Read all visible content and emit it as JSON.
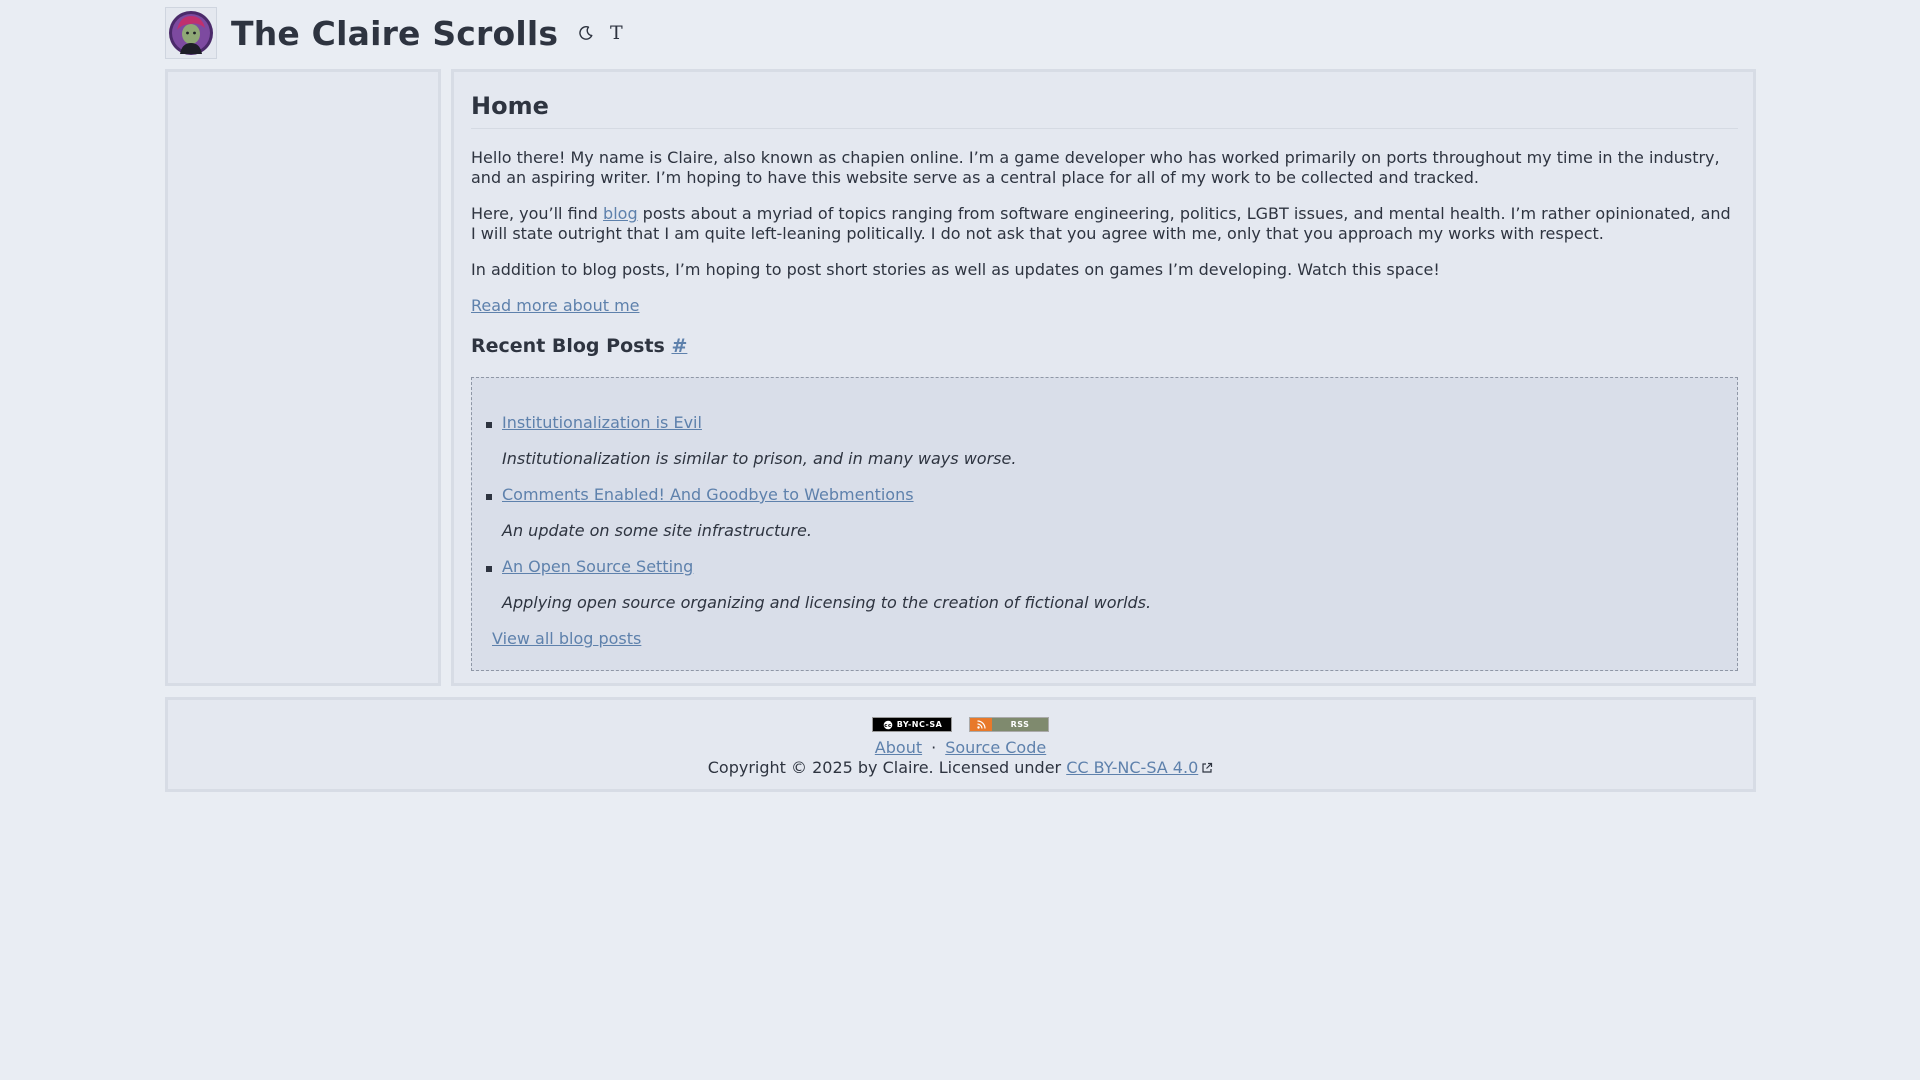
{
  "header": {
    "site_title": "The Claire Scrolls",
    "theme_toggle_icon": "moon-icon",
    "font_toggle_icon": "T"
  },
  "main": {
    "page_title": "Home",
    "intro": "Hello there! My name is Claire, also known as chapien online. I’m a game developer who has worked primarily on ports throughout my time in the industry, and an aspiring writer. I’m hoping to have this website serve as a central place for all of my work to be collected and tracked.",
    "topics_before": "Here, you’ll find ",
    "topics_link": "blog",
    "topics_after": " posts about a myriad of topics ranging from software engineering, politics, LGBT issues, and mental health. I’m rather opinionated, and I will state outright that I am quite left-leaning politically. I do not ask that you agree with me, only that you approach my works with respect.",
    "plans": "In addition to blog posts, I’m hoping to post short stories as well as updates on games I’m developing. Watch this space!",
    "read_more": "Read more about me",
    "recent_title": "Recent Blog Posts",
    "recent_anchor": "#",
    "posts": [
      {
        "title": "Institutionalization is Evil",
        "description": "Institutionalization is similar to prison, and in many ways worse."
      },
      {
        "title": "Comments Enabled! And Goodbye to Webmentions",
        "description": "An update on some site infrastructure."
      },
      {
        "title": "An Open Source Setting",
        "description": "Applying open source organizing and licensing to the creation of fictional worlds."
      }
    ],
    "view_all": "View all blog posts"
  },
  "footer": {
    "cc_badge": "BY-NC-SA",
    "rss_badge": "RSS",
    "about_link": "About",
    "separator": "·",
    "source_link": "Source Code",
    "copyright": "Copyright © 2025 by Claire. Licensed under ",
    "license_link": "CC BY-NC-SA 4.0"
  },
  "colors": {
    "background": "#e9edf3",
    "panel": "#e4e8f0",
    "link": "#5e81ac",
    "text": "#2e3440"
  }
}
